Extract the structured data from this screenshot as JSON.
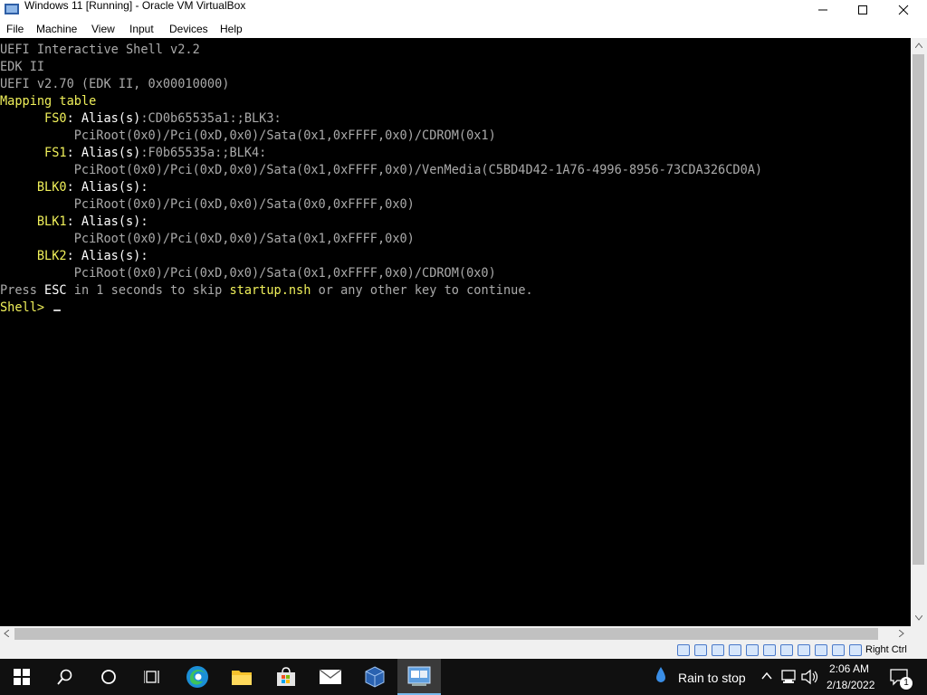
{
  "window": {
    "title": "Windows 11 [Running] - Oracle VM VirtualBox"
  },
  "menu": [
    "File",
    "Machine",
    "View",
    "Input",
    "Devices",
    "Help"
  ],
  "console": {
    "lines": [
      [
        {
          "t": "UEFI Interactive Shell v2.2",
          "c": "g"
        }
      ],
      [
        {
          "t": "EDK II",
          "c": "g"
        }
      ],
      [
        {
          "t": "UEFI v2.70 (EDK II, 0x00010000)",
          "c": "g"
        }
      ],
      [
        {
          "t": "Mapping table",
          "c": "y"
        }
      ],
      [
        {
          "t": "      FS0",
          "c": "y"
        },
        {
          "t": ": Alias(s)",
          "c": "w"
        },
        {
          "t": ":CD0b65535a1:;BLK3:",
          "c": "g"
        }
      ],
      [
        {
          "t": "          PciRoot(0x0)/Pci(0xD,0x0)/Sata(0x1,0xFFFF,0x0)/CDROM(0x1)",
          "c": "g"
        }
      ],
      [
        {
          "t": "      FS1",
          "c": "y"
        },
        {
          "t": ": Alias(s)",
          "c": "w"
        },
        {
          "t": ":F0b65535a:;BLK4:",
          "c": "g"
        }
      ],
      [
        {
          "t": "          PciRoot(0x0)/Pci(0xD,0x0)/Sata(0x1,0xFFFF,0x0)/VenMedia(C5BD4D42-1A76-4996-8956-73CDA326CD0A)",
          "c": "g"
        }
      ],
      [
        {
          "t": "     BLK0",
          "c": "y"
        },
        {
          "t": ": Alias(s):",
          "c": "w"
        }
      ],
      [
        {
          "t": "          PciRoot(0x0)/Pci(0xD,0x0)/Sata(0x0,0xFFFF,0x0)",
          "c": "g"
        }
      ],
      [
        {
          "t": "     BLK1",
          "c": "y"
        },
        {
          "t": ": Alias(s):",
          "c": "w"
        }
      ],
      [
        {
          "t": "          PciRoot(0x0)/Pci(0xD,0x0)/Sata(0x1,0xFFFF,0x0)",
          "c": "g"
        }
      ],
      [
        {
          "t": "     BLK2",
          "c": "y"
        },
        {
          "t": ": Alias(s):",
          "c": "w"
        }
      ],
      [
        {
          "t": "          PciRoot(0x0)/Pci(0xD,0x0)/Sata(0x1,0xFFFF,0x0)/CDROM(0x0)",
          "c": "g"
        }
      ],
      [
        {
          "t": "Press ",
          "c": "g"
        },
        {
          "t": "ESC",
          "c": "w"
        },
        {
          "t": " in 1 seconds to skip ",
          "c": "g"
        },
        {
          "t": "startup.nsh",
          "c": "y"
        },
        {
          "t": " or any other key to continue.",
          "c": "g"
        }
      ],
      [
        {
          "t": "Shell> ",
          "c": "y"
        }
      ]
    ]
  },
  "statusbar": {
    "icons": [
      "hard-disk-icon",
      "optical-drive-icon",
      "audio-icon",
      "network-icon",
      "usb-icon",
      "shared-folders-icon",
      "display-icon",
      "recording-icon",
      "cpu-icon",
      "mouse-integration-icon",
      "keyboard-icon"
    ],
    "host_key": "Right Ctrl"
  },
  "taskbar": {
    "apps": [
      "start-icon",
      "search-icon",
      "cortana-icon",
      "task-view-icon",
      "edge-icon",
      "file-explorer-icon",
      "store-icon",
      "mail-icon",
      "virtualbox-icon",
      "vm-window-icon"
    ],
    "weather": "Rain to stop",
    "time": "2:06 AM",
    "date": "2/18/2022",
    "notifications": "1"
  },
  "colors": {
    "console_yellow": "#f0f05a",
    "console_white": "#ffffff",
    "console_gray": "#aaaaaa",
    "taskbar_bg": "#101010",
    "accent": "#76b9ed"
  }
}
